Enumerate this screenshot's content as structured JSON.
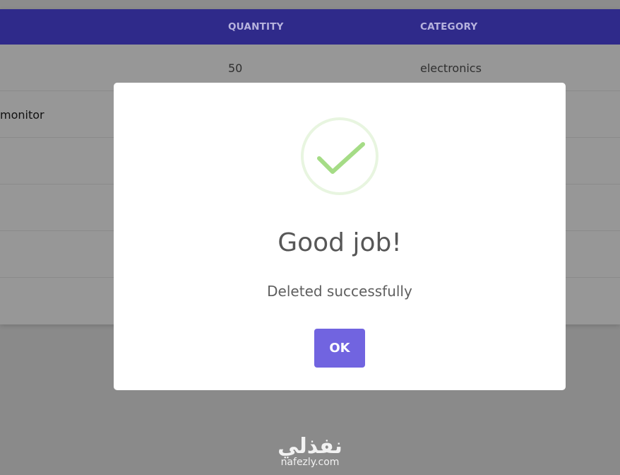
{
  "table": {
    "headers": {
      "quantity": "QUANTITY",
      "category": "CATEGORY"
    },
    "rows": [
      {
        "name": "",
        "quantity": "50",
        "category": "electronics"
      },
      {
        "name": "monitor",
        "quantity": "",
        "category": ""
      },
      {
        "name": "",
        "quantity": "",
        "category": ""
      },
      {
        "name": "",
        "quantity": "",
        "category": ""
      },
      {
        "name": "",
        "quantity": "",
        "category": ""
      },
      {
        "name": "",
        "quantity": "",
        "category": ""
      }
    ]
  },
  "modal": {
    "icon": "success-check-icon",
    "title": "Good job!",
    "text": "Deleted successfully",
    "ok_label": "OK",
    "accent": "#7164e0",
    "check_color": "#a5dc86"
  },
  "watermark": {
    "arabic": "نفذلي",
    "latin": "nafezly.com"
  }
}
